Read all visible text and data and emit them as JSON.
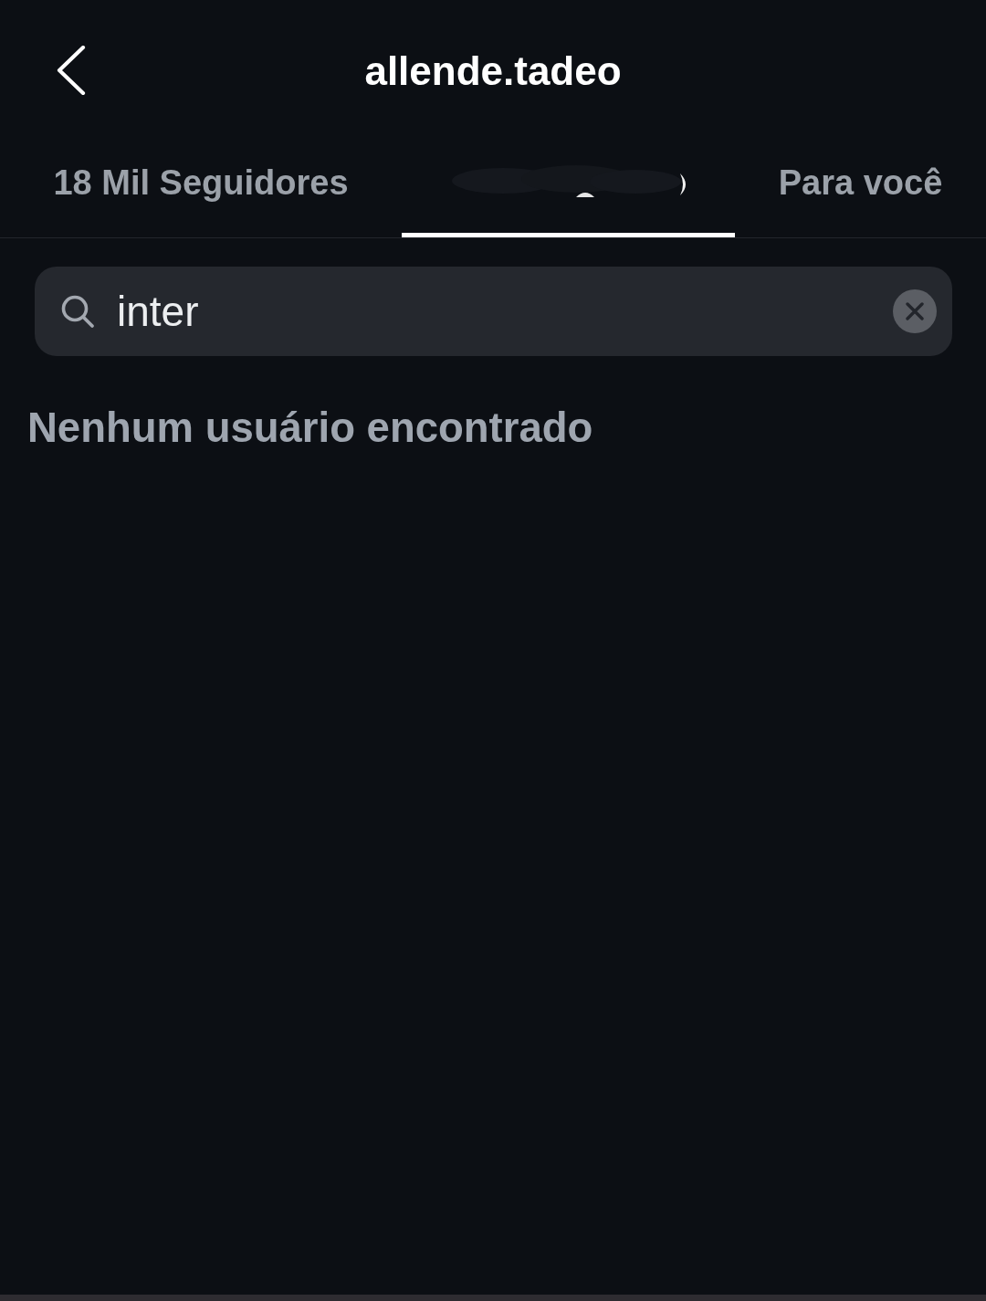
{
  "header": {
    "title": "allende.tadeo"
  },
  "tabs": [
    {
      "label": "18 Mil Seguidores",
      "selected": false
    },
    {
      "redacted": true,
      "selected": true
    },
    {
      "label": "Para você",
      "selected": false
    }
  ],
  "search": {
    "value": "inter"
  },
  "empty_state": {
    "message": "Nenhum usuário encontrado"
  }
}
